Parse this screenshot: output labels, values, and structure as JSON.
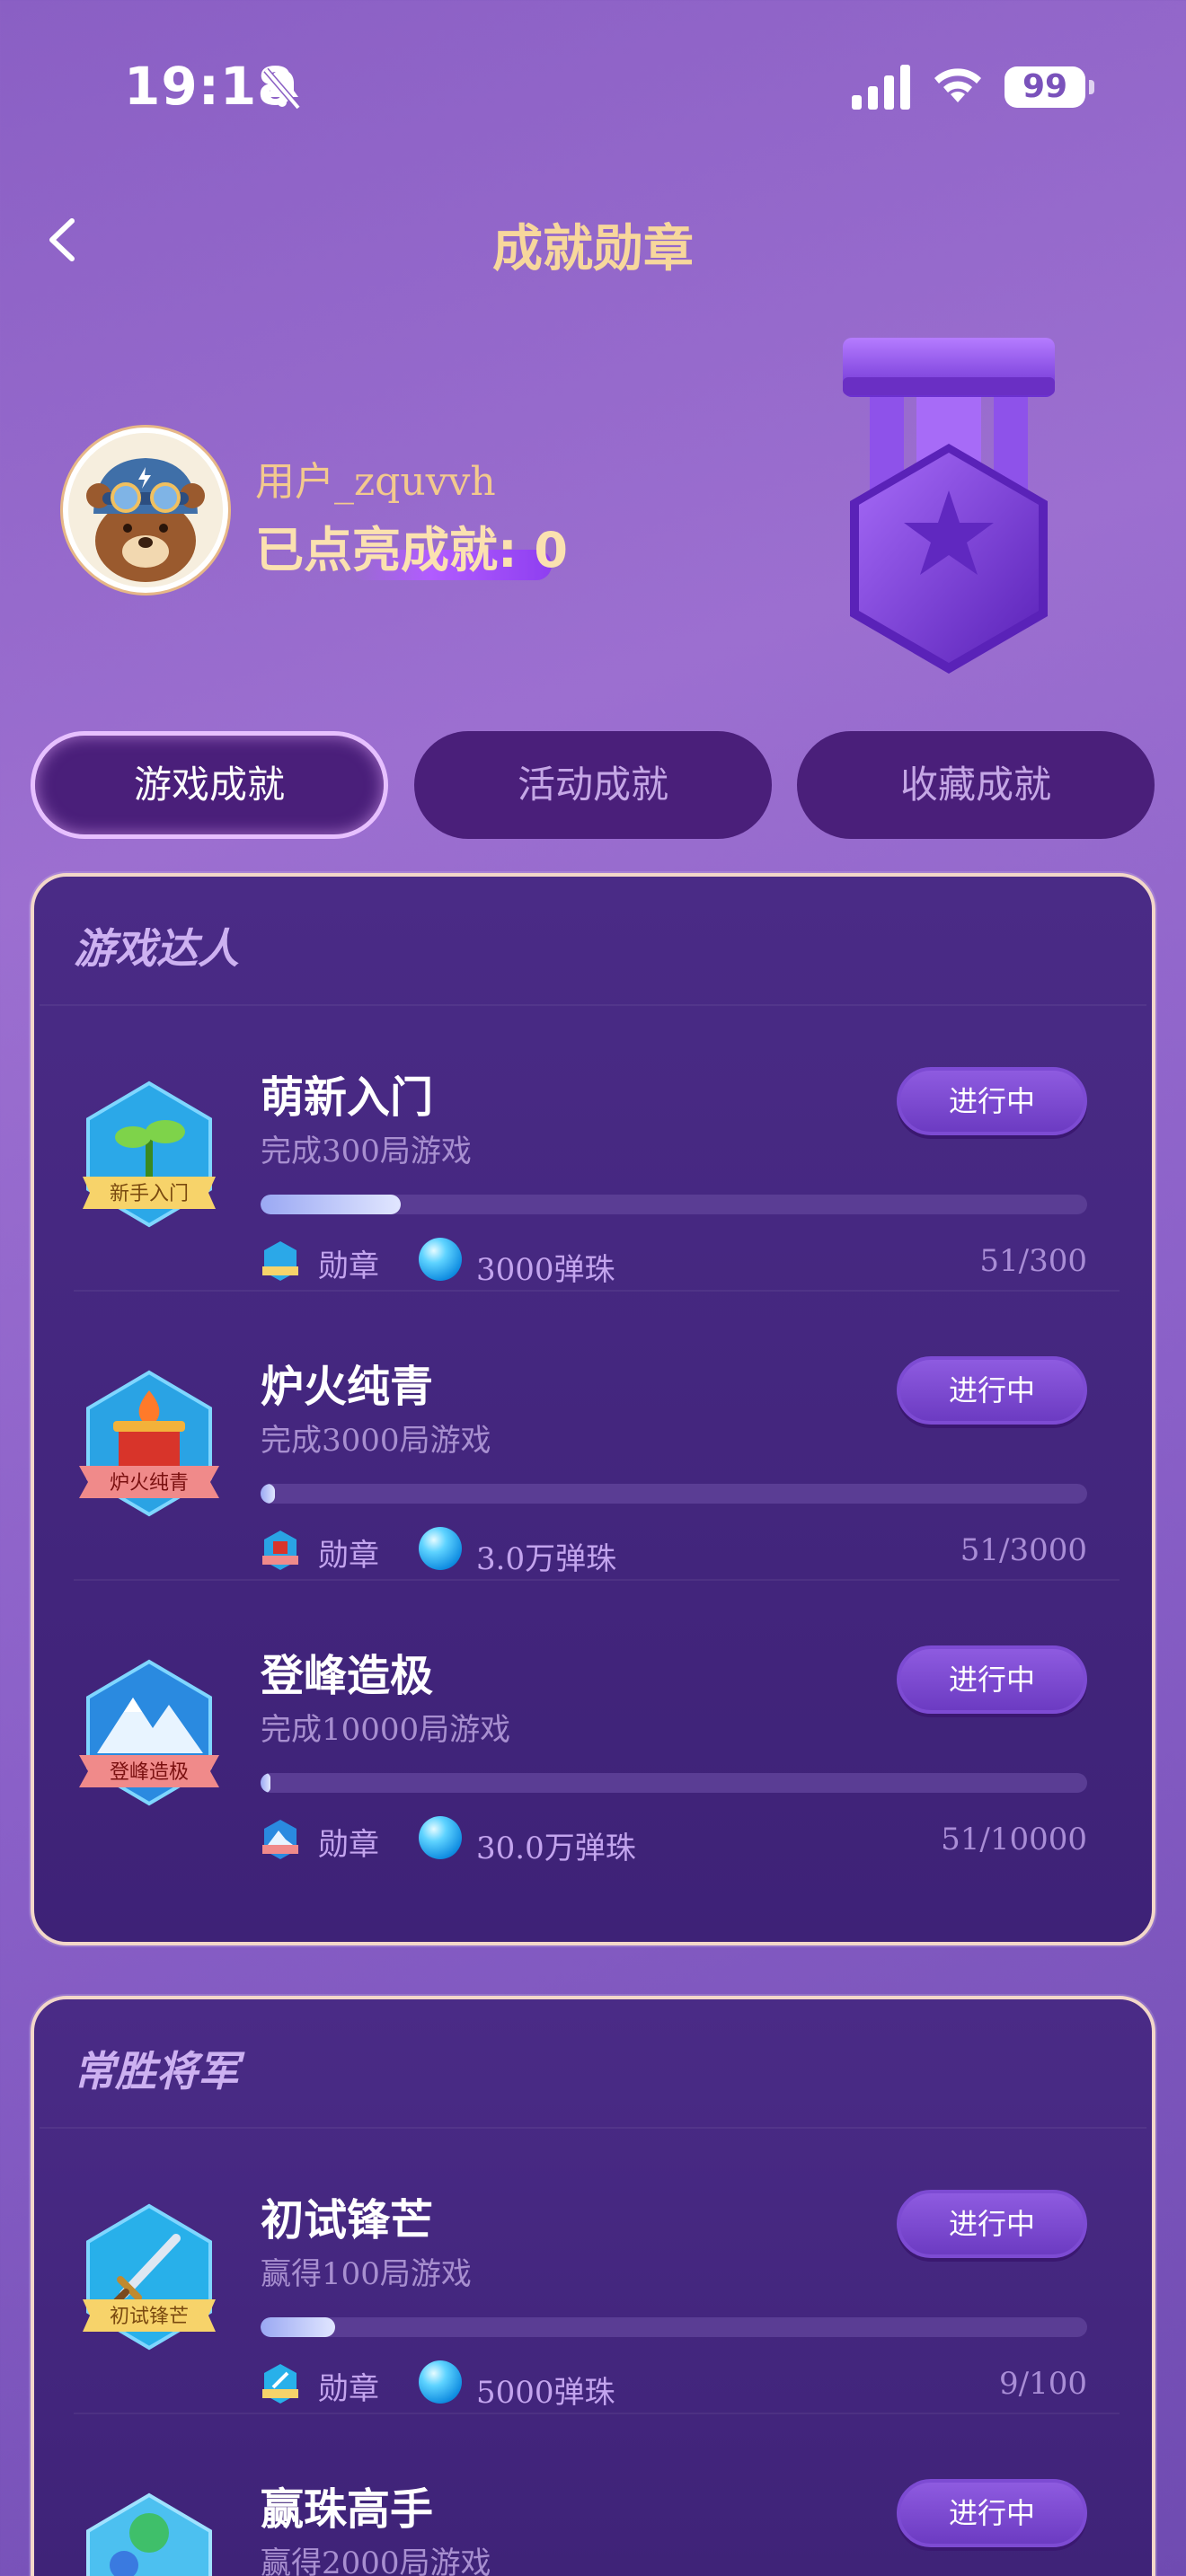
{
  "status_bar": {
    "time": "19:18",
    "battery": "99"
  },
  "header": {
    "title": "成就勋章"
  },
  "profile": {
    "username": "用户_zquvvh",
    "achievement_line": "已点亮成就: 0"
  },
  "tabs": [
    {
      "label": "游戏成就",
      "active": true
    },
    {
      "label": "活动成就",
      "active": false
    },
    {
      "label": "收藏成就",
      "active": false
    }
  ],
  "sections": [
    {
      "title": "游戏达人",
      "items": [
        {
          "name": "萌新入门",
          "desc": "完成300局游戏",
          "status": "进行中",
          "badge_text": "新手入门",
          "reward_label": "勋章",
          "reward_amount": "3000弹珠",
          "progress_text": "51/300",
          "progress": 0.17
        },
        {
          "name": "炉火纯青",
          "desc": "完成3000局游戏",
          "status": "进行中",
          "badge_text": "炉火纯青",
          "reward_label": "勋章",
          "reward_amount": "3.0万弹珠",
          "progress_text": "51/3000",
          "progress": 0.017
        },
        {
          "name": "登峰造极",
          "desc": "完成10000局游戏",
          "status": "进行中",
          "badge_text": "登峰造极",
          "reward_label": "勋章",
          "reward_amount": "30.0万弹珠",
          "progress_text": "51/10000",
          "progress": 0.005
        }
      ]
    },
    {
      "title": "常胜将军",
      "items": [
        {
          "name": "初试锋芒",
          "desc": "赢得100局游戏",
          "status": "进行中",
          "badge_text": "初试锋芒",
          "reward_label": "勋章",
          "reward_amount": "5000弹珠",
          "progress_text": "9/100",
          "progress": 0.09
        },
        {
          "name": "赢珠高手",
          "desc": "赢得2000局游戏",
          "status": "进行中"
        }
      ]
    }
  ],
  "colors": {
    "accent_gold": "#f7d79c",
    "tab_bg": "#4a1f7a",
    "card_bg": "#4a2b86",
    "progress_fill": "#9aa8f3"
  }
}
